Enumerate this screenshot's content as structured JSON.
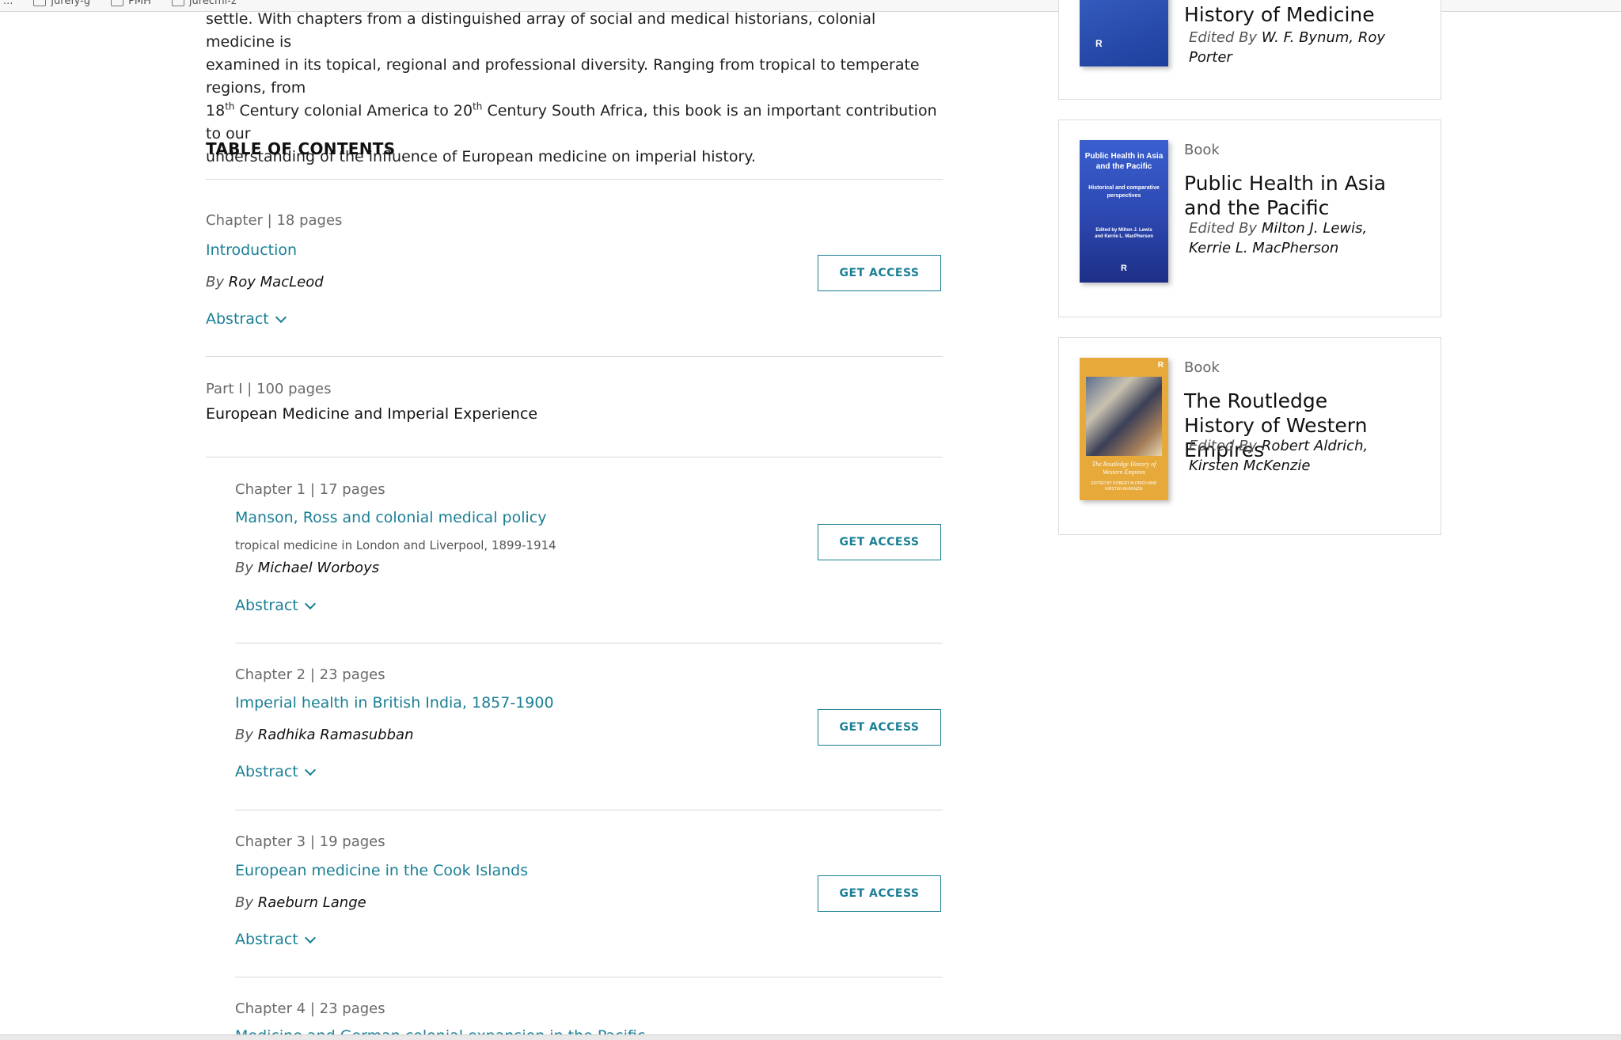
{
  "browser": {
    "crumbs": [
      "...",
      "jurefy-g",
      "PMH",
      "jurecmi-z"
    ]
  },
  "description": {
    "line1": "settle. With chapters from a distinguished array of social and medical historians, colonial medicine is",
    "line2": "examined in its topical, regional and professional diversity. Ranging from tropical to temperate regions, from",
    "line3_a": "18",
    "line3_sup1": "th",
    "line3_b": " Century colonial America to 20",
    "line3_sup2": "th",
    "line3_c": " Century South Africa, this book is an important contribution to our",
    "line4": "understanding of the influence of European medicine on imperial history."
  },
  "toc": {
    "title": "TABLE OF CONTENTS",
    "get_access": "GET ACCESS",
    "abstract": "Abstract",
    "by": "By",
    "entries": [
      {
        "meta": "Chapter | 18 pages",
        "title": "Introduction",
        "author": "Roy MacLeod"
      },
      {
        "meta": "Part I | 100 pages",
        "title": "European Medicine and Imperial Experience"
      },
      {
        "meta": "Chapter 1 | 17 pages",
        "title": "Manson, Ross and colonial medical policy",
        "subtitle": "tropical medicine in London and Liverpool, 1899-1914",
        "author": "Michael Worboys"
      },
      {
        "meta": "Chapter 2 | 23 pages",
        "title": "Imperial health in British India, 1857-1900",
        "author": "Radhika Ramasubban"
      },
      {
        "meta": "Chapter 3 | 19 pages",
        "title": "European medicine in the Cook Islands",
        "author": "Raeburn Lange"
      },
      {
        "meta": "Chapter 4 | 23 pages",
        "title": "Medicine and German colonial expansion in the Pacific"
      }
    ]
  },
  "related": {
    "edited_by": "Edited By",
    "cards": [
      {
        "type": "Book",
        "title": "History of Medicine",
        "editors": "W. F. Bynum, Roy Porter"
      },
      {
        "type": "Book",
        "title": "Public Health in Asia and the Pacific",
        "editors": "Milton J. Lewis, Kerrie L. MacPherson",
        "cover_title": "Public Health in Asia and the Pacific",
        "cover_sub": "Historical and comparative perspectives",
        "cover_eds": "Edited by Milton J. Lewis and Kerrie L. MacPherson"
      },
      {
        "type": "Book",
        "title": "The Routledge History of Western Empires",
        "editors": "Robert Aldrich, Kirsten McKenzie",
        "cover_title": "The Routledge History of Western Empires",
        "cover_eds": "EDITED BY ROBERT ALDRICH AND KIRSTEN McKENZIE"
      }
    ]
  },
  "colors": {
    "link": "#1a7f95",
    "cover_blue": "#2c47b0",
    "cover_gold": "#e6a93a"
  }
}
